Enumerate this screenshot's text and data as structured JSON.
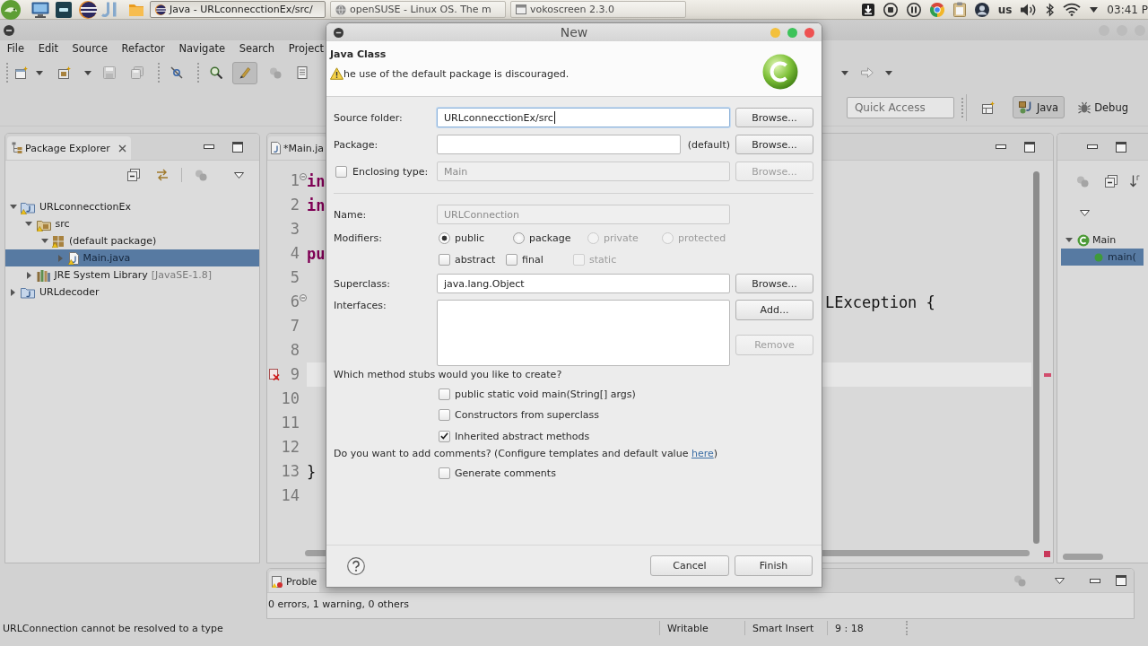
{
  "top_panel": {
    "tasks": [
      {
        "title": "Java - URLconnecctionEx/src/",
        "kind": "eclipse",
        "selected": true
      },
      {
        "title": "openSUSE - Linux OS. The m",
        "kind": "browser",
        "selected": false
      },
      {
        "title": "vokoscreen 2.3.0",
        "kind": "recorder",
        "selected": false
      }
    ],
    "keyboard_layout": "us",
    "clock": "03:41 P"
  },
  "menu": [
    "File",
    "Edit",
    "Source",
    "Refactor",
    "Navigate",
    "Search",
    "Project"
  ],
  "quick_access": {
    "placeholder": "Quick Access"
  },
  "perspectives": [
    {
      "label": "Java",
      "kind": "java",
      "selected": true
    },
    {
      "label": "Debug",
      "kind": "debug",
      "selected": false
    }
  ],
  "package_explorer": {
    "title": "Package Explorer",
    "tree": [
      {
        "label": "URLconnecctionEx",
        "kind": "project",
        "warning": true,
        "expanded": true,
        "selected": false,
        "children": [
          {
            "label": "src",
            "kind": "source-folder",
            "warning": true,
            "expanded": true,
            "selected": false,
            "children": [
              {
                "label": "(default package)",
                "kind": "package",
                "warning": true,
                "expanded": true,
                "selected": false,
                "children": [
                  {
                    "label": "Main.java",
                    "kind": "java-file",
                    "warning": true,
                    "expanded": false,
                    "selected": true
                  }
                ]
              }
            ]
          },
          {
            "label": "JRE System Library",
            "detail": "[JavaSE-1.8]",
            "kind": "library",
            "warning": false,
            "expanded": false,
            "selected": false
          }
        ]
      },
      {
        "label": "URLdecoder",
        "kind": "project",
        "warning": false,
        "expanded": false,
        "selected": false
      }
    ]
  },
  "editor": {
    "tab": "*Main.ja",
    "lines": [
      {
        "number": "1",
        "fold": true,
        "current": false,
        "error": false,
        "left": {
          "text": "in",
          "kind": "keyword"
        }
      },
      {
        "number": "2",
        "fold": false,
        "current": false,
        "error": false,
        "left": {
          "text": "in",
          "kind": "keyword"
        }
      },
      {
        "number": "3",
        "fold": false,
        "current": false,
        "error": false
      },
      {
        "number": "4",
        "fold": false,
        "current": false,
        "error": false,
        "left": {
          "text": "pu",
          "kind": "keyword"
        }
      },
      {
        "number": "5",
        "fold": false,
        "current": false,
        "error": false
      },
      {
        "number": "6",
        "fold": true,
        "current": false,
        "error": false,
        "right": {
          "text": "LException {",
          "kind": "plain"
        }
      },
      {
        "number": "7",
        "fold": false,
        "current": false,
        "error": false
      },
      {
        "number": "8",
        "fold": false,
        "current": false,
        "error": false
      },
      {
        "number": "9",
        "fold": false,
        "current": true,
        "error": true
      },
      {
        "number": "10",
        "fold": false,
        "current": false,
        "error": false
      },
      {
        "number": "11",
        "fold": false,
        "current": false,
        "error": false
      },
      {
        "number": "12",
        "fold": false,
        "current": false,
        "error": false
      },
      {
        "number": "13",
        "fold": false,
        "current": false,
        "error": false,
        "left": {
          "text": "}",
          "kind": "plain"
        }
      },
      {
        "number": "14",
        "fold": false,
        "current": false,
        "error": false
      }
    ]
  },
  "outline": {
    "tree": [
      {
        "label": "Main",
        "kind": "class",
        "expanded": true,
        "selected": false,
        "children": [
          {
            "label": "main(",
            "kind": "method",
            "selected": true
          }
        ]
      }
    ]
  },
  "problems": {
    "tab": "Proble",
    "summary": "0 errors, 1 warning, 0 others"
  },
  "status_bar": {
    "message": "URLConnection cannot be resolved to a type",
    "fields": [
      "Writable",
      "Smart Insert",
      "9 : 18"
    ]
  },
  "dialog": {
    "title": "New",
    "heading": "Java Class",
    "message": "he use of the default package is discouraged.",
    "source_folder": {
      "label": "Source folder:",
      "value": "URLconnecctionEx/src",
      "focused": true,
      "button": {
        "label": "Browse...",
        "disabled": false
      }
    },
    "package": {
      "label": "Package:",
      "suffix": "(default)",
      "button": {
        "label": "Browse...",
        "disabled": false
      }
    },
    "enclosing_type": {
      "label": "Enclosing type:",
      "checked": false,
      "value": "Main",
      "disabled": true,
      "button": {
        "label": "Browse...",
        "disabled": true
      }
    },
    "name": {
      "label": "Name:",
      "value": "URLConnection",
      "disabled": true
    },
    "modifiers": {
      "label": "Modifiers:",
      "access": [
        {
          "label": "public",
          "selected": true,
          "disabled": false
        },
        {
          "label": "package",
          "selected": false,
          "disabled": false
        },
        {
          "label": "private",
          "selected": false,
          "disabled": true
        },
        {
          "label": "protected",
          "selected": false,
          "disabled": true
        }
      ],
      "flags": [
        {
          "label": "abstract",
          "checked": false,
          "disabled": false
        },
        {
          "label": "final",
          "checked": false,
          "disabled": false
        },
        {
          "label": "static",
          "checked": false,
          "disabled": true
        }
      ]
    },
    "superclass": {
      "label": "Superclass:",
      "value": "java.lang.Object",
      "button": {
        "label": "Browse...",
        "disabled": false
      }
    },
    "interfaces": {
      "label": "Interfaces:",
      "buttons": [
        {
          "label": "Add...",
          "disabled": false
        },
        {
          "label": "Remove",
          "disabled": true
        }
      ]
    },
    "stubs": {
      "question": "Which method stubs would you like to create?",
      "options": [
        {
          "label": "public static void main(String[] args)",
          "checked": false
        },
        {
          "label": "Constructors from superclass",
          "checked": false
        },
        {
          "label": "Inherited abstract methods",
          "checked": true
        }
      ]
    },
    "comments": {
      "question_start": "Do you want to add comments? (Configure templates and default value ",
      "link": "here",
      "question_end": ")",
      "option": {
        "label": "Generate comments",
        "checked": false
      }
    },
    "buttons": [
      {
        "label": "Cancel",
        "disabled": false
      },
      {
        "label": "Finish",
        "disabled": false
      }
    ]
  }
}
